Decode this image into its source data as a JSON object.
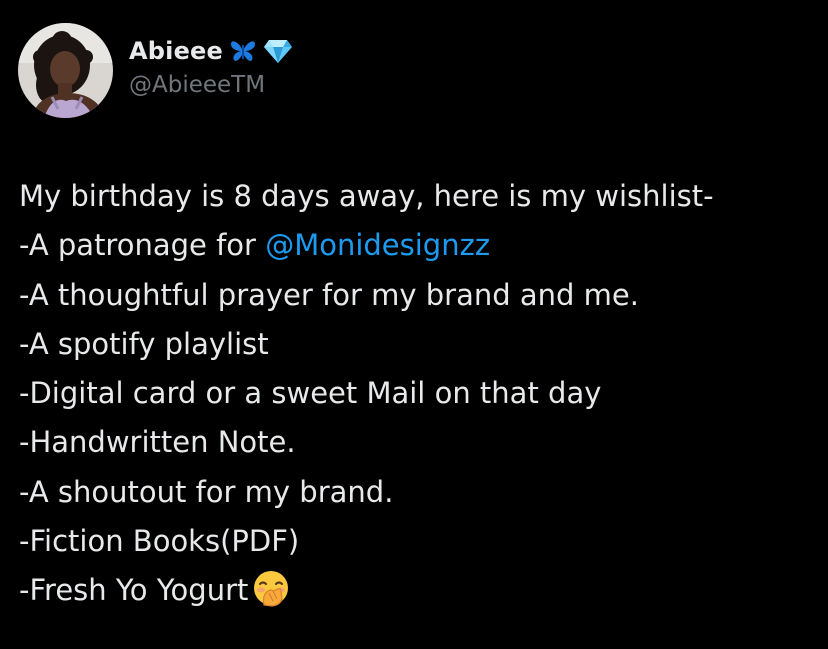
{
  "author": {
    "display_name": "Abieee",
    "handle": "@AbieeeTM",
    "badge_icons": [
      "blue-butterfly-icon",
      "gem-stone-icon"
    ],
    "avatar": "avatar-photo"
  },
  "tweet": {
    "lines": [
      "My birthday is 8 days away, here is my wishlist-",
      "-A patronage for ",
      "-A thoughtful prayer for my brand and me.",
      "-A spotify playlist",
      "-Digital card or a sweet Mail on that day",
      "-Handwritten Note.",
      "-A shoutout for my brand.",
      "-Fiction Books(PDF)",
      "-Fresh Yo Yogurt"
    ],
    "mention": "@Monidesignzz",
    "trailing_emoji": "hand-over-mouth-face-icon"
  },
  "colors": {
    "background": "#000000",
    "text": "#e7e9ea",
    "handle": "#71767b",
    "mention": "#1d9bf0"
  }
}
